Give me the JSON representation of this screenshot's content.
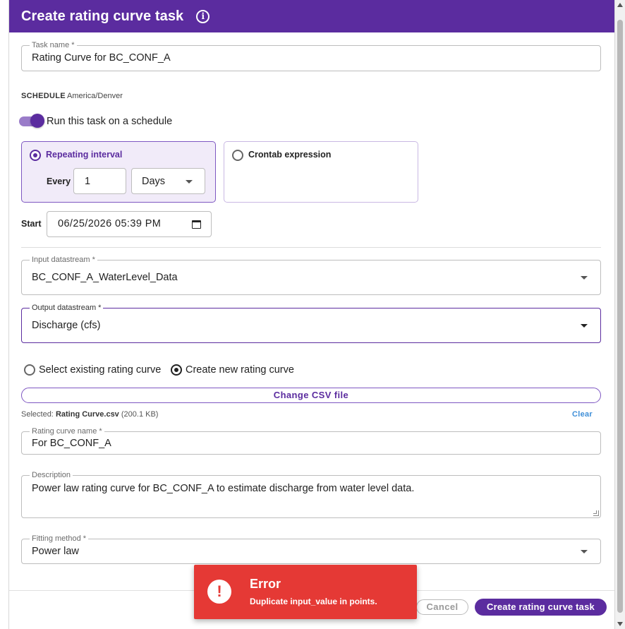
{
  "dialog": {
    "title": "Create rating curve task",
    "info_icon": "info-icon"
  },
  "task_name": {
    "label": "Task name *",
    "value": "Rating Curve for BC_CONF_A"
  },
  "schedule": {
    "heading": "SCHEDULE",
    "timezone": "America/Denver",
    "toggle_label": "Run this task on a schedule",
    "toggle_on": true,
    "repeating": {
      "title": "Repeating interval",
      "every_label": "Every",
      "every_value": "1",
      "unit": "Days",
      "selected": true
    },
    "crontab": {
      "title": "Crontab expression",
      "selected": false
    },
    "start_label": "Start",
    "start_value": "06/25/2026 05:39 PM"
  },
  "input_datastream": {
    "label": "Input datastream *",
    "value": "BC_CONF_A_WaterLevel_Data"
  },
  "output_datastream": {
    "label": "Output datastream *",
    "value": "Discharge (cfs)"
  },
  "curve_source": {
    "existing_label": "Select existing rating curve",
    "new_label": "Create new rating curve",
    "selected": "new"
  },
  "csv": {
    "button_label": "Change CSV file",
    "selected_prefix": "Selected:",
    "file_name": "Rating Curve.csv",
    "file_size": "(200.1 KB)",
    "clear_label": "Clear"
  },
  "rating_curve_name": {
    "label": "Rating curve name *",
    "value": "For BC_CONF_A"
  },
  "description": {
    "label": "Description",
    "value": "Power law rating curve for BC_CONF_A to estimate discharge from water level data."
  },
  "fitting_method": {
    "label": "Fitting method *",
    "value": "Power law"
  },
  "footer": {
    "cancel_label": "Cancel",
    "create_label": "Create rating curve task"
  },
  "toast": {
    "icon": "!",
    "title": "Error",
    "message": "Duplicate input_value in points."
  },
  "colors": {
    "primary": "#5b2c9f",
    "error": "#e53935",
    "link": "#3f8fd8"
  }
}
